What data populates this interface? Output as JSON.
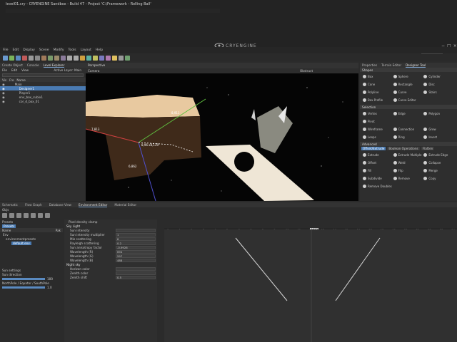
{
  "window": {
    "title": "level01.cry - CRYENGINE Sandbox - Build 47 - Project 'C:\\Framework - Rolling Ball'",
    "brand": "CRYENGINE",
    "search_placeholder": "Search"
  },
  "menu": [
    "File",
    "Edit",
    "Display",
    "Scene",
    "Modify",
    "Tools",
    "Layout",
    "Help"
  ],
  "left_panel": {
    "tabs": [
      "Create Object",
      "Console",
      "Level Explorer"
    ],
    "menu": [
      "File",
      "Edit",
      "View"
    ],
    "active_layer": "Active Layer: Main",
    "column_name": "Name",
    "col_labels": [
      "Vis",
      "Fro"
    ],
    "tree": [
      {
        "name": "Main",
        "selected": false,
        "indent": 0
      },
      {
        "name": "Designer1",
        "selected": true,
        "indent": 1
      },
      {
        "name": "Player1",
        "selected": false,
        "indent": 1
      },
      {
        "name": "env_box_cubix1",
        "selected": false,
        "indent": 1
      },
      {
        "name": "cor_d_box_01",
        "selected": false,
        "indent": 1
      }
    ]
  },
  "viewport": {
    "tab": "Perspective",
    "camera": "Camera",
    "mode": "Obstruct",
    "dims": [
      "8,911",
      "7,813",
      "6,862",
      "8,96 x8,139"
    ]
  },
  "right_panel": {
    "tabs": [
      "Properties",
      "Terrain Editor",
      "Designer Tool"
    ],
    "shapes_header": "Shapes",
    "shapes": [
      "Box",
      "Sphere",
      "Cylinder",
      "Cone",
      "Rectangle",
      "Disc",
      "Polyline",
      "Curve",
      "Stairs",
      "Box Profile",
      "Curve Editor",
      ""
    ],
    "selection_header": "Selection",
    "selection": [
      "Vertex",
      "Edge",
      "Polygon",
      "Pivot",
      "",
      "",
      "Wireframe",
      "Connection",
      "Grow",
      "Loops",
      "Ring",
      "Invert"
    ],
    "advanced_header": "Advanced",
    "advanced_tabs": [
      "Offset/Extrude",
      "Boolean Operations",
      "Flatten"
    ],
    "advanced": [
      "Extrude",
      "Extrude Multiple",
      "Extrude Edge",
      "Offset",
      "Weld",
      "Collapse",
      "Fill",
      "Flip",
      "Merge",
      "Subdivide",
      "Remove",
      "Copy",
      "Remove Doubles",
      "",
      ""
    ]
  },
  "bottom": {
    "tabs": [
      "Schematic",
      "Flow Graph",
      "Database View",
      "Environment Editor",
      "Material Editor"
    ],
    "toolbar_label": "Objs",
    "presets_label": "Presets",
    "presets_tab": "Presets",
    "list_header": [
      "Name",
      "Pak"
    ],
    "presets_tree": [
      "Env",
      "environmentpresets",
      "default.env"
    ],
    "sun_settings": "Sun settings",
    "sun_direction": "Sun direction",
    "sun_dir_value": "180",
    "north_pole": "NorthPole / Equator / SouthPole",
    "north_value": "1.0",
    "props": {
      "pixel_density": "Pixel density clamp",
      "sky_light_header": "Sky Light",
      "sky_light": [
        {
          "label": "Sun intensity",
          "value": ""
        },
        {
          "label": "Sun intensity multiplier",
          "value": "1"
        },
        {
          "label": "Mie scattering",
          "value": "8"
        },
        {
          "label": "Rayleigh scattering",
          "value": "0.2"
        },
        {
          "label": "Sun anisotropy factor",
          "value": "-0.9926"
        },
        {
          "label": "Wavelength (R)",
          "value": "694"
        },
        {
          "label": "Wavelength (G)",
          "value": "597"
        },
        {
          "label": "Wavelength (B)",
          "value": "488"
        }
      ],
      "night_sky_header": "Night sky",
      "night_sky": [
        {
          "label": "Horizon color",
          "value": ""
        },
        {
          "label": "Zenith color",
          "value": ""
        },
        {
          "label": "Zenith shift",
          "value": "0.5"
        }
      ]
    },
    "timeline_marker": "1013",
    "timeline_ticks": [
      "0",
      "1",
      "2",
      "3",
      "4",
      "5",
      "6",
      "7",
      "8",
      "9",
      "10",
      "11",
      "12",
      "13",
      "14",
      "15",
      "16",
      "17",
      "18",
      "19",
      "20",
      "21",
      "22",
      "23",
      "24"
    ]
  }
}
